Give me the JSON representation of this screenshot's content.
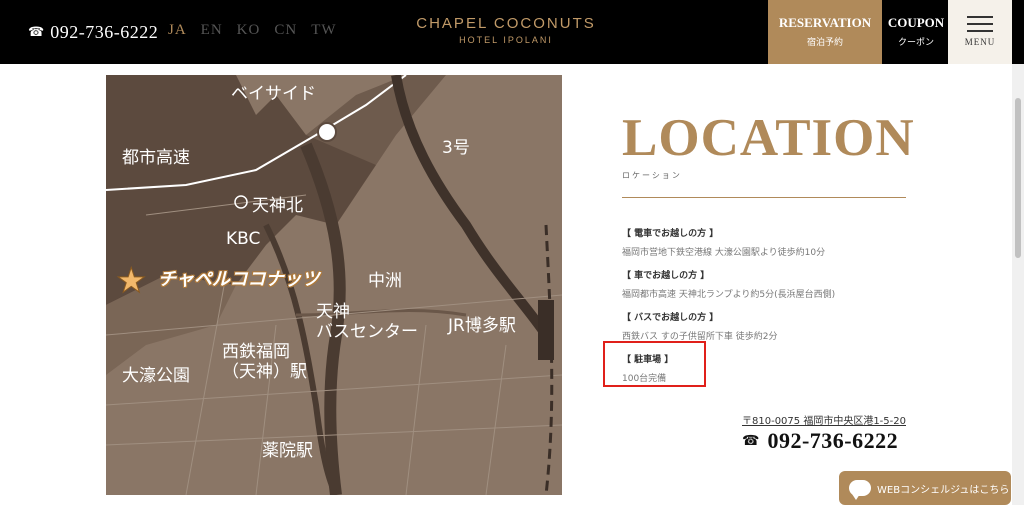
{
  "header": {
    "phone_icon": "☎",
    "phone": "092-736-6222",
    "languages": [
      {
        "label": "JA",
        "active": true
      },
      {
        "label": "EN",
        "active": false
      },
      {
        "label": "KO",
        "active": false
      },
      {
        "label": "CN",
        "active": false
      },
      {
        "label": "TW",
        "active": false
      }
    ],
    "logo_main": "CHAPEL COCONUTS",
    "logo_sub": "HOTEL IPOLANI",
    "reservation_label": "RESERVATION",
    "reservation_sub": "宿泊予約",
    "coupon_label": "COUPON",
    "coupon_sub": "クーポン",
    "menu_label": "MENU"
  },
  "map": {
    "labels": {
      "bayside": "ベイサイド",
      "toshi_kosoku": "都市高速",
      "route3": "3号",
      "tenjin_kita": "天神北",
      "kbc": "KBC",
      "chapel": "チャペルココナッツ",
      "nakasu": "中洲",
      "tenjin_bus": "天神\nバスセンター",
      "jr_hakata": "JR博多駅",
      "ohori": "大濠公園",
      "nishitetsu": "西鉄福岡\n（天神）駅",
      "yakuin": "薬院駅"
    }
  },
  "location": {
    "title": "LOCATION",
    "subtitle": "ロケーション",
    "access": [
      {
        "heading": "【 電車でお越しの方 】",
        "body": "福岡市営地下鉄空港線 大濠公園駅より徒歩約10分"
      },
      {
        "heading": "【 車でお越しの方 】",
        "body": "福岡都市高速 天神北ランプより約5分(長浜屋台西側)"
      },
      {
        "heading": "【 バスでお越しの方 】",
        "body": "西鉄バス すの子供留所下車 徒歩約2分"
      },
      {
        "heading": "【 駐車場 】",
        "body": "100台完備"
      }
    ],
    "address": "〒810-0075 福岡市中央区港1-5-20",
    "phone_icon": "☎",
    "phone": "092-736-6222"
  },
  "chat": {
    "label": "WEBコンシェルジュはこちら"
  },
  "colors": {
    "accent": "#b08a5a",
    "header_bg": "#000000",
    "highlight": "#e0201a",
    "map_bg": "#8a7666"
  }
}
